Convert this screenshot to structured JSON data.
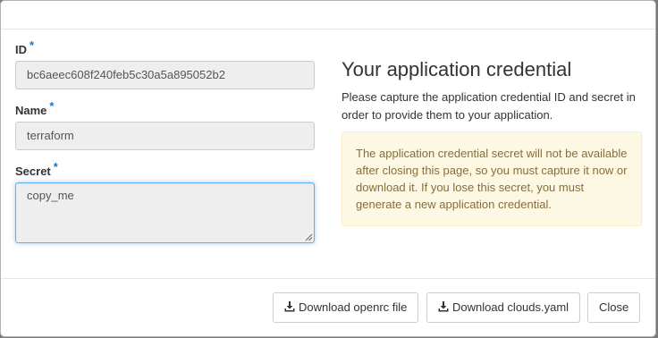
{
  "form": {
    "id": {
      "label": "ID",
      "required_mark": "*",
      "value": "bc6aeec608f240feb5c30a5a895052b2"
    },
    "name": {
      "label": "Name",
      "required_mark": "*",
      "value": "terraform"
    },
    "secret": {
      "label": "Secret",
      "required_mark": "*",
      "value": "copy_me"
    }
  },
  "info": {
    "heading": "Your application credential",
    "description": "Please capture the application credential ID and secret in order to provide them to your application.",
    "warning": "The application credential secret will not be available after closing this page, so you must capture it now or download it. If you lose this secret, you must generate a new application credential."
  },
  "footer": {
    "download_openrc_label": "Download openrc file",
    "download_clouds_label": "Download clouds.yaml",
    "close_label": "Close",
    "download_icon": "download-icon"
  },
  "colors": {
    "required_mark": "#1a76c4",
    "warning_bg": "#fcf8e3",
    "warning_text": "#8a6d3b",
    "focus_border": "#66afe9"
  }
}
